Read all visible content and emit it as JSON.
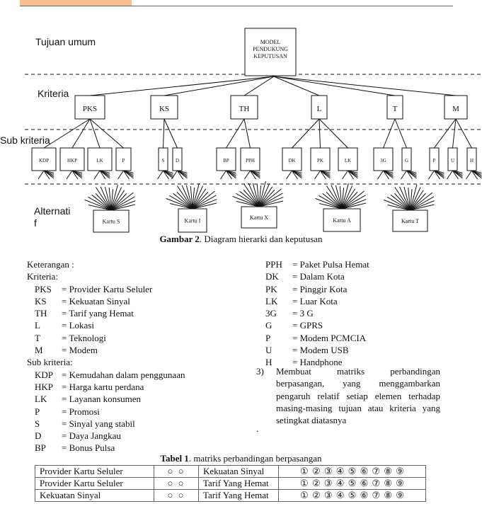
{
  "header": {
    "accent_color": "#f9bf8f"
  },
  "diagram": {
    "level_labels": {
      "goal": "Tujuan umum",
      "criteria": "Kriteria",
      "subcriteria": "Sub kriteria",
      "alternatives": "Alternati\nf"
    },
    "goal_box": [
      "MODEL",
      "PENDUKUNG",
      "KEPUTUSAN"
    ],
    "criteria": [
      "PKS",
      "KS",
      "TH",
      "L",
      "T",
      "M"
    ],
    "subcriteria": [
      {
        "parent": "PKS",
        "items": [
          "KDP",
          "HKP",
          "LK",
          "P"
        ]
      },
      {
        "parent": "KS",
        "items": [
          "S",
          "D"
        ]
      },
      {
        "parent": "TH",
        "items": [
          "BP",
          "PPH"
        ]
      },
      {
        "parent": "L",
        "items": [
          "DK",
          "PK",
          "LK"
        ]
      },
      {
        "parent": "T",
        "items": [
          "3G",
          "G"
        ]
      },
      {
        "parent": "M",
        "items": [
          "P",
          "U",
          "H"
        ]
      }
    ],
    "alternatives": [
      "Kartu S",
      "Kartu I",
      "Kartu X",
      "Kartu A",
      "Kartu T"
    ],
    "caption_bold": "Gambar 2",
    "caption_rest": ". Diagram hierarki dan keputusan"
  },
  "legend": {
    "title": "Keterangan :",
    "criteria_heading": "Kriteria:",
    "criteria": [
      {
        "abbr": "PKS",
        "text": "= Provider Kartu Seluler"
      },
      {
        "abbr": "KS",
        "text": "= Kekuatan Sinyal"
      },
      {
        "abbr": "TH",
        "text": "= Tarif yang Hemat"
      },
      {
        "abbr": "L",
        "text": "= Lokasi"
      },
      {
        "abbr": "T",
        "text": "= Teknologi"
      },
      {
        "abbr": "M",
        "text": "= Modem"
      }
    ],
    "sub_heading": "Sub kriteria:",
    "sub_left": [
      {
        "abbr": "KDP",
        "text": "= Kemudahan dalam penggunaan"
      },
      {
        "abbr": "HKP",
        "text": "= Harga kartu perdana"
      },
      {
        "abbr": "LK",
        "text": "= Layanan konsumen"
      },
      {
        "abbr": "P",
        "text": "= Promosi"
      },
      {
        "abbr": "S",
        "text": "= Sinyal yang stabil"
      },
      {
        "abbr": "D",
        "text": "= Daya Jangkau"
      },
      {
        "abbr": "BP",
        "text": "= Bonus Pulsa"
      }
    ],
    "sub_right": [
      {
        "abbr": "PPH",
        "text": "= Paket Pulsa Hemat"
      },
      {
        "abbr": "DK",
        "text": "= Dalam Kota"
      },
      {
        "abbr": "PK",
        "text": "= Pinggir Kota"
      },
      {
        "abbr": "LK",
        "text": "= Luar Kota"
      },
      {
        "abbr": "3G",
        "text": "= 3 G"
      },
      {
        "abbr": "G",
        "text": "= GPRS"
      },
      {
        "abbr": "P",
        "text": "= Modem PCMCIA"
      },
      {
        "abbr": "U",
        "text": "= Modem USB"
      },
      {
        "abbr": "H",
        "text": "= Handphone"
      }
    ]
  },
  "step3": {
    "number": "3)",
    "text": "Membuat matriks perbandingan berpasangan, yang menggambarkan pengaruh relatif setiap elemen terhadap masing-masing tujuan atau kriteria yang setingkat diatasnya",
    "trailing": "."
  },
  "table": {
    "caption_bold": "Tabel 1",
    "caption_rest": ". matriks perbandingan berpasangan",
    "rows": [
      {
        "left": "Provider Kartu Seluler",
        "choice": "○ ○",
        "right": "Kekuatan Sinyal",
        "scale": "① ② ③ ④ ⑤ ⑥ ⑦ ⑧ ⑨"
      },
      {
        "left": "Provider Kartu Seluler",
        "choice": "○ ○",
        "right": "Tarif Yang Hemat",
        "scale": "① ② ③ ④ ⑤ ⑥ ⑦ ⑧ ⑨"
      },
      {
        "left": "Kekuatan Sinyal",
        "choice": "○ ○",
        "right": "Tarif Yang Hemat",
        "scale": "① ② ③ ④ ⑤ ⑥ ⑦ ⑧ ⑨"
      }
    ]
  }
}
